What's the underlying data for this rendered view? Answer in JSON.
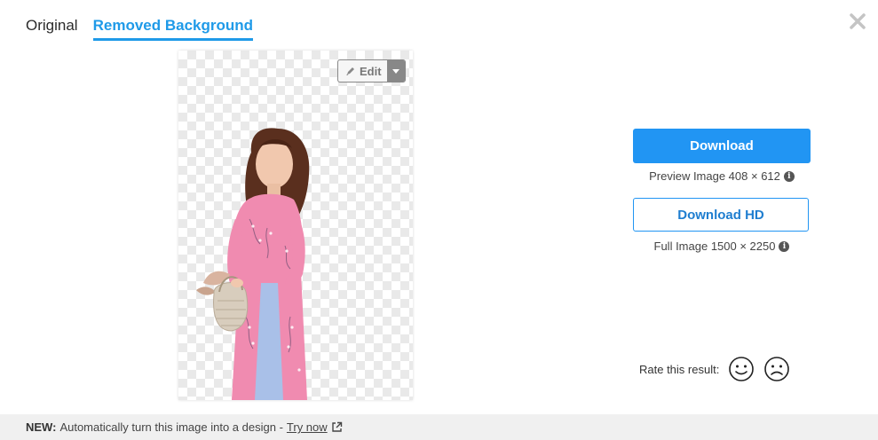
{
  "tabs": [
    {
      "label": "Original",
      "active": false
    },
    {
      "label": "Removed Background",
      "active": true
    }
  ],
  "preview": {
    "edit_label": "Edit",
    "description": "Woman in pink floral ao dai holding a woven handbag, background removed"
  },
  "download": {
    "button_label": "Download",
    "caption": "Preview Image 408 × 612"
  },
  "download_hd": {
    "button_label": "Download HD",
    "caption": "Full Image 1500 × 2250"
  },
  "rating": {
    "label": "Rate this result:"
  },
  "footer": {
    "new_label": "NEW:",
    "message": "Automatically turn this image into a design -",
    "link_label": "Try now"
  },
  "colors": {
    "accent": "#2195f3",
    "tab_active": "#1f9ae8",
    "footer_bg": "#f0f0f0"
  },
  "icons": [
    "close-icon",
    "pencil-icon",
    "chevron-down-icon",
    "info-icon",
    "smile-icon",
    "frown-icon",
    "external-link-icon"
  ]
}
